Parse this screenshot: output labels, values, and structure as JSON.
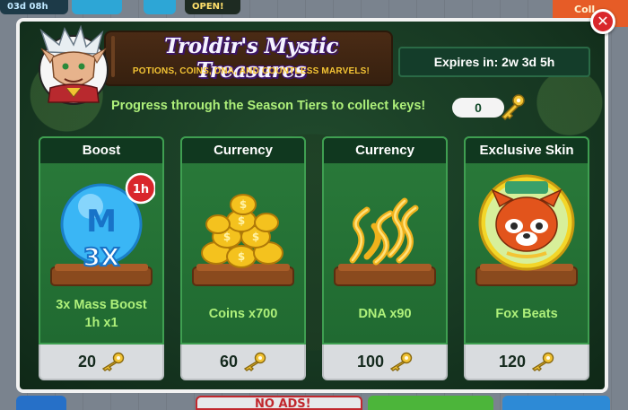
{
  "background": {
    "timer": "03d 08h",
    "open_label": "OPEN!",
    "right_tag": "Coll",
    "no_ads_label": "NO ADS!"
  },
  "modal": {
    "title": "Troldir's Mystic Treasures",
    "subtitle": "POTIONS, COINS, DNA, AND COUNTLESS MARVELS!",
    "expires": "Expires in: 2w 3d 5h",
    "progress_text": "Progress through the Season Tiers to collect keys!",
    "keys_count": "0",
    "close_symbol": "✕"
  },
  "cards": [
    {
      "category": "Boost",
      "label_line1": "3x Mass Boost",
      "label_line2": "1h x1",
      "price": "20",
      "icon": "mass-boost-icon",
      "badge": "1h",
      "boost_letter": "M",
      "boost_mult": "3X"
    },
    {
      "category": "Currency",
      "label_line1": "Coins x700",
      "label_line2": "",
      "price": "60",
      "icon": "coins-pile-icon"
    },
    {
      "category": "Currency",
      "label_line1": "DNA x90",
      "label_line2": "",
      "price": "100",
      "icon": "dna-pile-icon"
    },
    {
      "category": "Exclusive Skin",
      "label_line1": "Fox Beats",
      "label_line2": "",
      "price": "120",
      "icon": "fox-skin-icon"
    }
  ],
  "colors": {
    "panel_green": "#206a31",
    "header_dark": "#10381f",
    "label_green": "#aef07a",
    "gold": "#f3c434",
    "close_red": "#d9262b"
  }
}
